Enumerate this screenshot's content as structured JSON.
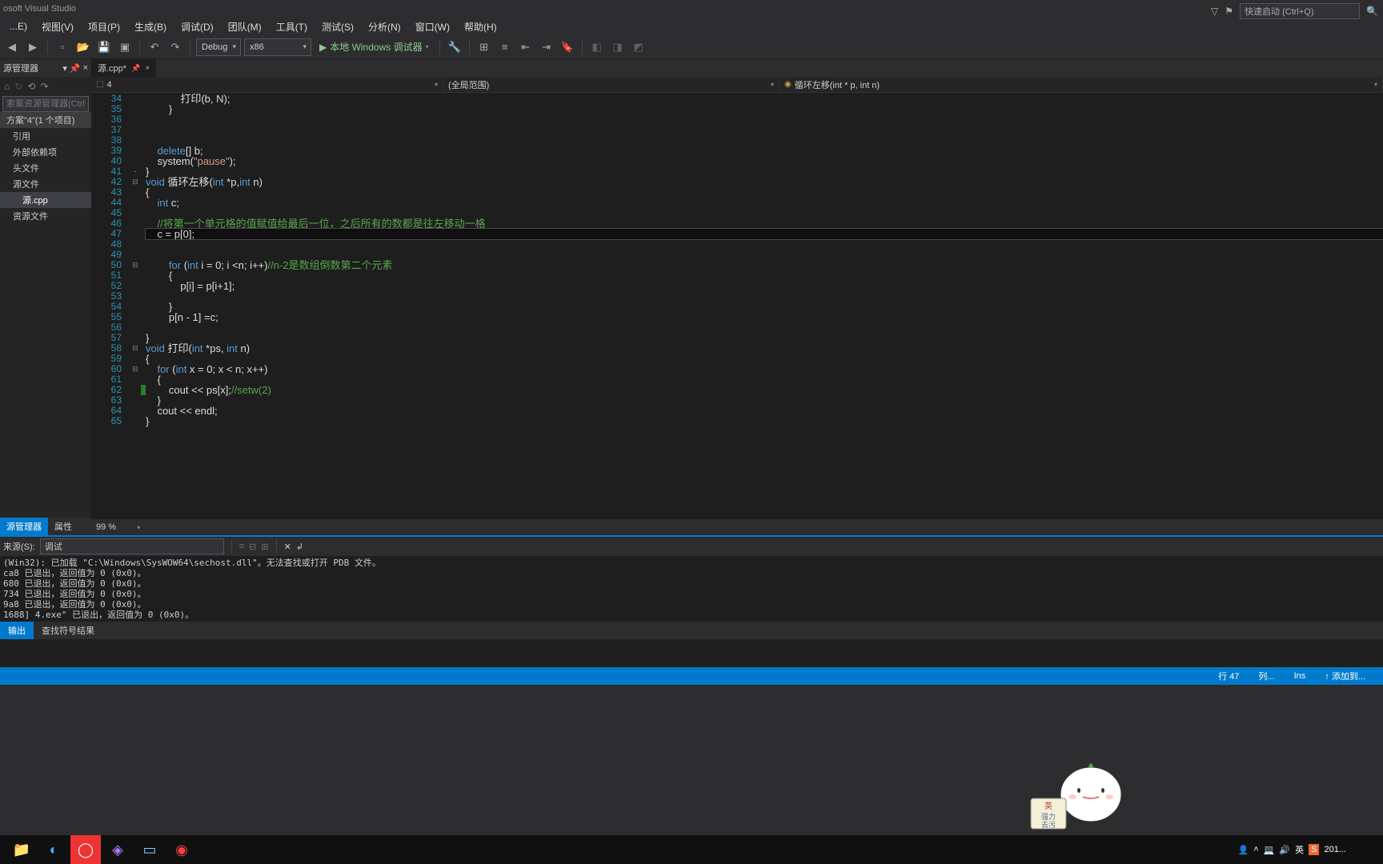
{
  "window": {
    "title": "osoft Visual Studio"
  },
  "quicklaunch": {
    "placeholder": "快速启动 (Ctrl+Q)"
  },
  "menu": {
    "file": "...E)",
    "view": "视图(V)",
    "project": "项目(P)",
    "build": "生成(B)",
    "debug": "调试(D)",
    "team": "团队(M)",
    "tools": "工具(T)",
    "test": "测试(S)",
    "analyze": "分析(N)",
    "window": "窗口(W)",
    "help": "帮助(H)"
  },
  "toolbar": {
    "config": "Debug",
    "platform": "x86",
    "start": "本地 Windows 调试器",
    "playglyph": "▶"
  },
  "sidebar": {
    "title": "源管理器",
    "search_placeholder": "索案资源管理器(Ctrl",
    "solution": "方案\"4\"(1 个项目)",
    "nodes": {
      "refs": "引用",
      "extern": "外部依赖项",
      "headers": "头文件",
      "sources": "源文件",
      "srcfile": "源.cpp",
      "resources": "资源文件"
    },
    "tabs": {
      "explorer": "源管理器",
      "props": "属性"
    }
  },
  "editor": {
    "tab": "源.cpp*",
    "tab_close": "×",
    "nav1": "4",
    "nav2": "(全局范围)",
    "nav3": "循环左移(int * p, int n)",
    "zoom": "99 %"
  },
  "code": [
    {
      "n": 34,
      "t": "            打印(b, N);"
    },
    {
      "n": 35,
      "t": "        }"
    },
    {
      "n": 36,
      "t": ""
    },
    {
      "n": 37,
      "t": ""
    },
    {
      "n": 38,
      "t": ""
    },
    {
      "n": 39,
      "t": "    delete[] b;",
      "tokens": [
        {
          "s": "    ",
          "c": ""
        },
        {
          "s": "delete",
          "c": "kw"
        },
        {
          "s": "[] b;",
          "c": ""
        }
      ]
    },
    {
      "n": 40,
      "t": "    system(\"pause\");",
      "tokens": [
        {
          "s": "    system(",
          "c": ""
        },
        {
          "s": "\"pause\"",
          "c": "str"
        },
        {
          "s": ");",
          "c": ""
        }
      ]
    },
    {
      "n": 41,
      "t": "}",
      "fold": "-"
    },
    {
      "n": 42,
      "fold": "⊟",
      "tokens": [
        {
          "s": "void",
          "c": "kw"
        },
        {
          "s": " 循环左移(",
          "c": ""
        },
        {
          "s": "int",
          "c": "kw"
        },
        {
          "s": " *p,",
          "c": ""
        },
        {
          "s": "int",
          "c": "kw"
        },
        {
          "s": " n)",
          "c": ""
        }
      ]
    },
    {
      "n": 43,
      "t": "{"
    },
    {
      "n": 44,
      "tokens": [
        {
          "s": "    ",
          "c": ""
        },
        {
          "s": "int",
          "c": "kw"
        },
        {
          "s": " c;",
          "c": ""
        }
      ]
    },
    {
      "n": 45,
      "t": ""
    },
    {
      "n": 46,
      "tokens": [
        {
          "s": "    ",
          "c": ""
        },
        {
          "s": "//将第一个单元格的值赋值给最后一位，之后所有的数都是往左移动一格",
          "c": "cmt"
        }
      ]
    },
    {
      "n": 47,
      "t": "    c = p[0];",
      "hl": true
    },
    {
      "n": 48,
      "t": ""
    },
    {
      "n": 49,
      "t": ""
    },
    {
      "n": 50,
      "fold": "⊟",
      "tokens": [
        {
          "s": "        ",
          "c": ""
        },
        {
          "s": "for",
          "c": "kw"
        },
        {
          "s": " (",
          "c": ""
        },
        {
          "s": "int",
          "c": "kw"
        },
        {
          "s": " i = 0; i <n; i++)",
          "c": ""
        },
        {
          "s": "//n-2是数组倒数第二个元素",
          "c": "cmt"
        }
      ]
    },
    {
      "n": 51,
      "t": "        {"
    },
    {
      "n": 52,
      "t": "            p[i] = p[i+1];"
    },
    {
      "n": 53,
      "t": ""
    },
    {
      "n": 54,
      "t": "        }"
    },
    {
      "n": 55,
      "t": "        p[n - 1] =c;"
    },
    {
      "n": 56,
      "t": ""
    },
    {
      "n": 57,
      "t": "}"
    },
    {
      "n": 58,
      "fold": "⊟",
      "tokens": [
        {
          "s": "void",
          "c": "kw"
        },
        {
          "s": " 打印(",
          "c": ""
        },
        {
          "s": "int",
          "c": "kw"
        },
        {
          "s": " *ps, ",
          "c": ""
        },
        {
          "s": "int",
          "c": "kw"
        },
        {
          "s": " n)",
          "c": ""
        }
      ]
    },
    {
      "n": 59,
      "t": "{"
    },
    {
      "n": 60,
      "fold": "⊟",
      "tokens": [
        {
          "s": "    ",
          "c": ""
        },
        {
          "s": "for",
          "c": "kw"
        },
        {
          "s": " (",
          "c": ""
        },
        {
          "s": "int",
          "c": "kw"
        },
        {
          "s": " x = 0; x < n; x++)",
          "c": ""
        }
      ]
    },
    {
      "n": 61,
      "t": "    {"
    },
    {
      "n": 62,
      "mark": "green",
      "tokens": [
        {
          "s": "        cout << ps[x];",
          "c": ""
        },
        {
          "s": "//setw(2)",
          "c": "cmt"
        }
      ]
    },
    {
      "n": 63,
      "t": "    }"
    },
    {
      "n": 64,
      "t": "    cout << endl;"
    },
    {
      "n": 65,
      "t": "}"
    }
  ],
  "output": {
    "label_src": "来源(S):",
    "dropdown_val": "调试",
    "lines": [
      "(Win32): 已加载 \"C:\\Windows\\SysWOW64\\sechost.dll\"。无法查找或打开 PDB 文件。",
      "ca8 已退出，返回值为 0 (0x0)。",
      "680 已退出，返回值为 0 (0x0)。",
      "734 已退出，返回值为 0 (0x0)。",
      "9a8 已退出，返回值为 0 (0x0)。",
      "1688] 4.exe\" 已退出，返回值为 0 (0x0)。"
    ],
    "tabs": {
      "output": "输出",
      "findsym": "查找符号结果"
    }
  },
  "status": {
    "line": "行 47",
    "col": "列...",
    "ins": "Ins",
    "add": "↑ 添加到..."
  },
  "taskbar_time": "201...",
  "taskbar_lang": "英"
}
